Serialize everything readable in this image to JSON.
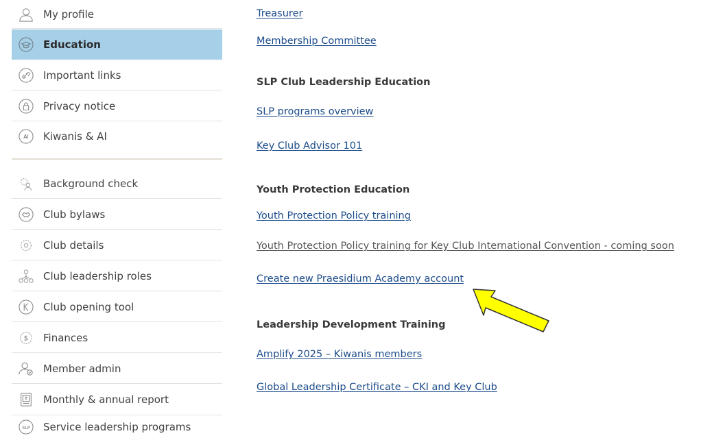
{
  "sidebar": {
    "group1": [
      {
        "label": "My profile",
        "icon": "user-icon"
      },
      {
        "label": "Education",
        "icon": "graduation-cap-icon",
        "active": true
      },
      {
        "label": "Important links",
        "icon": "link-icon"
      },
      {
        "label": "Privacy notice",
        "icon": "lock-icon"
      },
      {
        "label": "Kiwanis & AI",
        "icon": "ai-badge-icon",
        "badge": "AI"
      }
    ],
    "group2": [
      {
        "label": "Background check",
        "icon": "background-check-icon"
      },
      {
        "label": "Club bylaws",
        "icon": "handshake-icon"
      },
      {
        "label": "Club details",
        "icon": "gear-icon"
      },
      {
        "label": "Club leadership roles",
        "icon": "org-chart-icon"
      },
      {
        "label": "Club opening tool",
        "icon": "kiwanis-k-icon"
      },
      {
        "label": "Finances",
        "icon": "dollar-gear-icon"
      },
      {
        "label": "Member admin",
        "icon": "user-check-icon"
      },
      {
        "label": "Monthly & annual report",
        "icon": "report-icon"
      },
      {
        "label": "Service leadership programs",
        "icon": "slp-badge-icon",
        "badge": "SLP"
      }
    ]
  },
  "content": {
    "treasurer": "Treasurer",
    "membership_committee": "Membership Committee",
    "slp_heading": "SLP Club Leadership Education",
    "slp_overview": "SLP programs overview",
    "key_club_advisor": "Key Club Advisor 101",
    "ype_heading": "Youth Protection Education",
    "ypp_training": "Youth Protection Policy training",
    "ypp_kci": "Youth Protection Policy training for Key Club International Convention - coming soon",
    "praesidium": "Create new Praesidium Academy account",
    "ldt_heading": "Leadership Development Training",
    "amplify": "Amplify 2025 – Kiwanis members",
    "glc": "Global Leadership Certificate – CKI and Key Club"
  },
  "colors": {
    "active_bg": "#a6cfe8",
    "link": "#1c4c8a",
    "arrow_fill": "#ffff00"
  }
}
